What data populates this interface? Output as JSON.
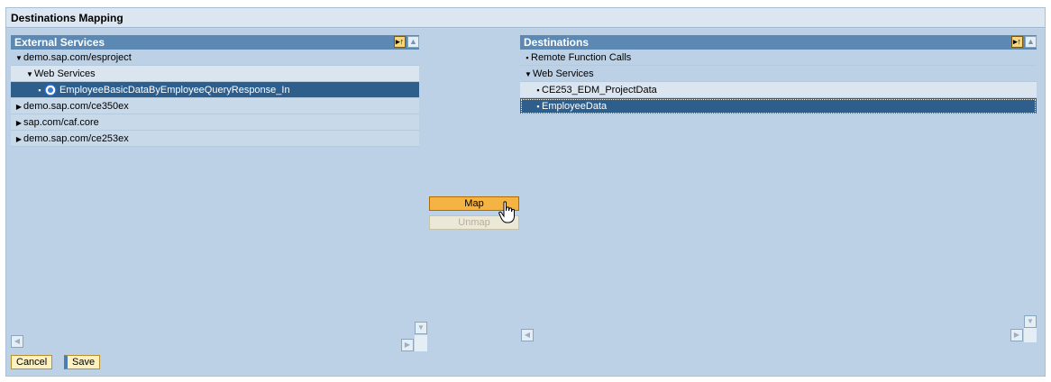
{
  "window": {
    "title": "Destinations Mapping"
  },
  "left_panel": {
    "title": "External Services",
    "tree": [
      {
        "label": "demo.sap.com/esproject",
        "expander": "expanded",
        "level": 0,
        "style": "plain"
      },
      {
        "label": "Web Services",
        "expander": "expanded",
        "level": 1,
        "style": "light"
      },
      {
        "label": "EmployeeBasicDataByEmployeeQueryResponse_In",
        "expander": "leaf",
        "level": 2,
        "style": "selected",
        "icon": "web-service-icon"
      },
      {
        "label": "demo.sap.com/ce350ex",
        "expander": "collapsed",
        "level": 0,
        "style": "mid"
      },
      {
        "label": "sap.com/caf.core",
        "expander": "collapsed",
        "level": 0,
        "style": "mid"
      },
      {
        "label": "demo.sap.com/ce253ex",
        "expander": "collapsed",
        "level": 0,
        "style": "mid"
      }
    ]
  },
  "right_panel": {
    "title": "Destinations",
    "tree": [
      {
        "label": "Remote Function Calls",
        "expander": "leaf",
        "level": 0,
        "style": "plain"
      },
      {
        "label": "Web Services",
        "expander": "expanded",
        "level": 0,
        "style": "plain"
      },
      {
        "label": "CE253_EDM_ProjectData",
        "expander": "leaf",
        "level": 1,
        "style": "light"
      },
      {
        "label": "EmployeeData",
        "expander": "leaf",
        "level": 1,
        "style": "selected-focus"
      }
    ]
  },
  "actions": {
    "map_label": "Map",
    "unmap_label": "Unmap"
  },
  "footer": {
    "cancel_label": "Cancel",
    "save_label": "Save"
  },
  "colors": {
    "header_blue": "#5b89b4",
    "selection_blue": "#2e5e8c",
    "map_orange": "#f5b343",
    "panel_background": "#bcd1e5"
  }
}
